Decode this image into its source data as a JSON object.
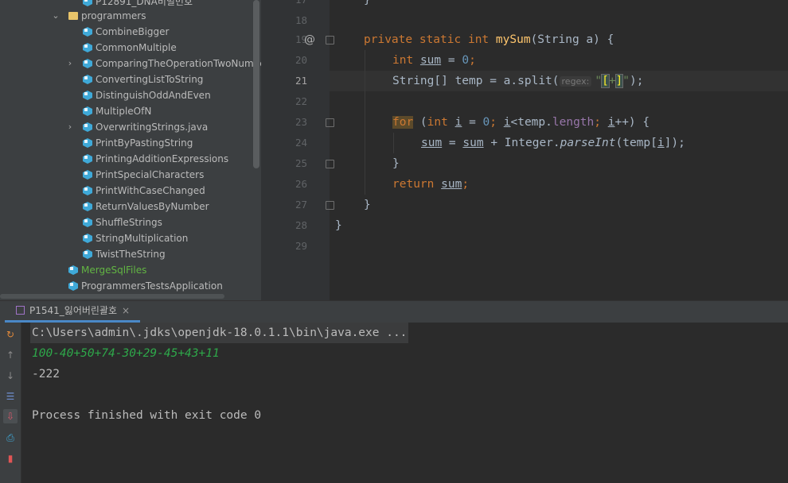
{
  "project_tree": {
    "items": [
      {
        "label": "P12891_DNA비밀번호",
        "kind": "class",
        "indent": 2,
        "chevron": false
      },
      {
        "label": "programmers",
        "kind": "folder",
        "indent": 1,
        "chevron": true,
        "expanded": true
      },
      {
        "label": "CombineBigger",
        "kind": "class",
        "indent": 2,
        "chevron": false
      },
      {
        "label": "CommonMultiple",
        "kind": "class",
        "indent": 2,
        "chevron": false
      },
      {
        "label": "ComparingTheOperationTwoNumbers.java",
        "kind": "class",
        "indent": 2,
        "chevron": true
      },
      {
        "label": "ConvertingListToString",
        "kind": "class",
        "indent": 2,
        "chevron": false
      },
      {
        "label": "DistinguishOddAndEven",
        "kind": "class",
        "indent": 2,
        "chevron": false
      },
      {
        "label": "MultipleOfN",
        "kind": "class",
        "indent": 2,
        "chevron": false
      },
      {
        "label": "OverwritingStrings.java",
        "kind": "class",
        "indent": 2,
        "chevron": true
      },
      {
        "label": "PrintByPastingString",
        "kind": "class",
        "indent": 2,
        "chevron": false
      },
      {
        "label": "PrintingAdditionExpressions",
        "kind": "class",
        "indent": 2,
        "chevron": false
      },
      {
        "label": "PrintSpecialCharacters",
        "kind": "class",
        "indent": 2,
        "chevron": false
      },
      {
        "label": "PrintWithCaseChanged",
        "kind": "class",
        "indent": 2,
        "chevron": false
      },
      {
        "label": "ReturnValuesByNumber",
        "kind": "class",
        "indent": 2,
        "chevron": false
      },
      {
        "label": "ShuffleStrings",
        "kind": "class",
        "indent": 2,
        "chevron": false
      },
      {
        "label": "StringMultiplication",
        "kind": "class",
        "indent": 2,
        "chevron": false
      },
      {
        "label": "TwistTheString",
        "kind": "class",
        "indent": 2,
        "chevron": false
      },
      {
        "label": "MergeSqlFiles",
        "kind": "class-green",
        "indent": 1,
        "chevron": false
      },
      {
        "label": "ProgrammersTestsApplication",
        "kind": "class",
        "indent": 1,
        "chevron": false
      }
    ]
  },
  "editor": {
    "line_numbers": [
      "17",
      "18",
      "19",
      "20",
      "21",
      "22",
      "23",
      "24",
      "25",
      "26",
      "27",
      "28",
      "29"
    ],
    "active_line": "21",
    "annotation_marker": "@",
    "code": {
      "l17": "}",
      "l19_mod1": "private",
      "l19_mod2": "static",
      "l19_type": "int",
      "l19_name": "mySum",
      "l19_params": "(String a) {",
      "l20_type": "int",
      "l20_var": "sum",
      "l20_eq": " = ",
      "l20_num": "0",
      "l20_end": ";",
      "l21_start": "String[] temp = a.split(",
      "l21_hint": "regex:",
      "l21_str_open": "\"",
      "l21_regex_open": "[",
      "l21_regex_plus": "+",
      "l21_regex_close": "]",
      "l21_str_close": "\"",
      "l21_end": ");",
      "l23_for": "for",
      "l23_open": " (",
      "l23_int": "int",
      "l23_i1": "i",
      "l23_eq": " = ",
      "l23_zero": "0",
      "l23_semi1": "; ",
      "l23_i2": "i",
      "l23_mid": "<temp.",
      "l23_length": "length",
      "l23_semi2": "; ",
      "l23_i3": "i",
      "l23_close": "++) {",
      "l24_sum1": "sum",
      "l24_eq": " = ",
      "l24_sum2": "sum",
      "l24_plus": " + Integer.",
      "l24_parse": "parseInt",
      "l24_arg": "(temp[",
      "l24_i": "i",
      "l24_end": "]);",
      "l25": "}",
      "l26_return": "return",
      "l26_sum": "sum",
      "l26_end": ";",
      "l27": "}",
      "l28": "}"
    }
  },
  "run_panel": {
    "tab_label": "P1541_잃어버린괄호",
    "close_glyph": "×",
    "command": "C:\\Users\\admin\\.jdks\\openjdk-18.0.1.1\\bin\\java.exe ...",
    "input": "100-40+50+74-30+29-45+43+11",
    "output": "-222",
    "exit": "Process finished with exit code 0",
    "side_icons": [
      "rerun-icon",
      "scroll-up-icon",
      "scroll-down-icon",
      "soft-wrap-icon",
      "scroll-to-end-icon",
      "print-icon",
      "trash-icon"
    ]
  },
  "colors": {
    "keyword": "#cc7832",
    "method": "#ffc66d",
    "number": "#6897bb",
    "string": "#6a8759",
    "field": "#9876aa",
    "console_input": "#2ea84a",
    "accent": "#4a88c7"
  }
}
